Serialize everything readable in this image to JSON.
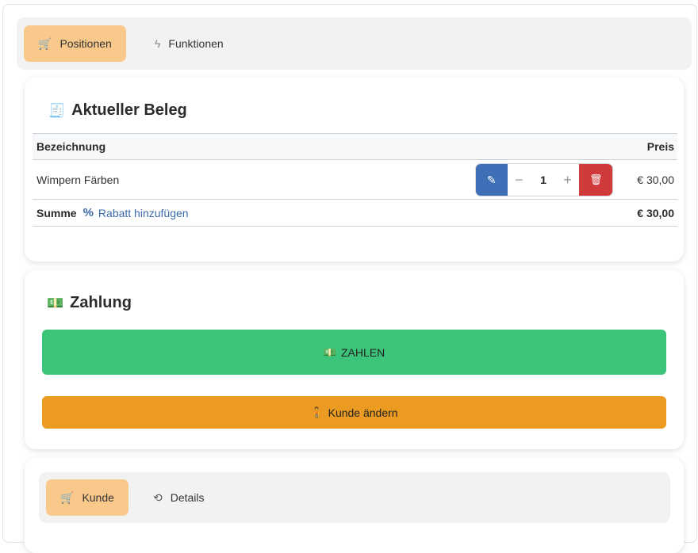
{
  "tabs_top": [
    {
      "label": "Positionen",
      "icon": "cart-icon",
      "active": true
    },
    {
      "label": "Funktionen",
      "icon": "lightning-icon",
      "active": false
    }
  ],
  "beleg": {
    "title": "Aktueller Beleg",
    "col_name": "Bezeichnung",
    "col_price": "Preis",
    "items": [
      {
        "name": "Wimpern Färben",
        "quantity": "1",
        "price": "€ 30,00"
      }
    ],
    "sum_label": "Summe",
    "rabatt_label": "Rabatt hinzufügen",
    "sum_value": "€ 30,00"
  },
  "zahlung": {
    "title": "Zahlung",
    "pay_label": "ZAHLEN",
    "customer_label": "Kunde ändern"
  },
  "tabs_bottom": [
    {
      "label": "Kunde",
      "icon": "cart-icon",
      "active": true
    },
    {
      "label": "Details",
      "icon": "history-icon",
      "active": false
    }
  ],
  "colors": {
    "active_tab": "#f9c98c",
    "pay_button": "#3cc47a",
    "customer_button": "#eb9a22",
    "edit_button": "#3f6fb6",
    "delete_button": "#d13a3a",
    "link": "#3d6aa8"
  }
}
